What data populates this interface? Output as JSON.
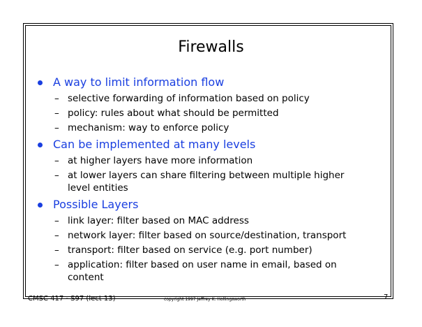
{
  "slide": {
    "title": "Firewalls",
    "bullets": [
      {
        "text": "A way to limit information flow",
        "subs": [
          "selective forwarding of information based on policy",
          "policy: rules about what should be permitted",
          "mechanism: way to enforce policy"
        ]
      },
      {
        "text": "Can be implemented at many levels",
        "subs": [
          "at higher layers have more information",
          "at lower layers can share filtering between multiple higher level entities"
        ]
      },
      {
        "text": "Possible Layers",
        "subs": [
          "link layer: filter based on MAC address",
          "network layer: filter based on source/destination, transport",
          "transport: filter based on service (e.g. port number)",
          "application: filter based on user name in email, based on content"
        ]
      }
    ]
  },
  "footer": {
    "course": "CMSC 417 - S97 (lect 13)",
    "copyright": "copyright 1997 Jeffrey K. Hollingsworth",
    "page_number": "7"
  },
  "colors": {
    "bullet_color": "#1a3fe0",
    "text_color": "#000000"
  }
}
